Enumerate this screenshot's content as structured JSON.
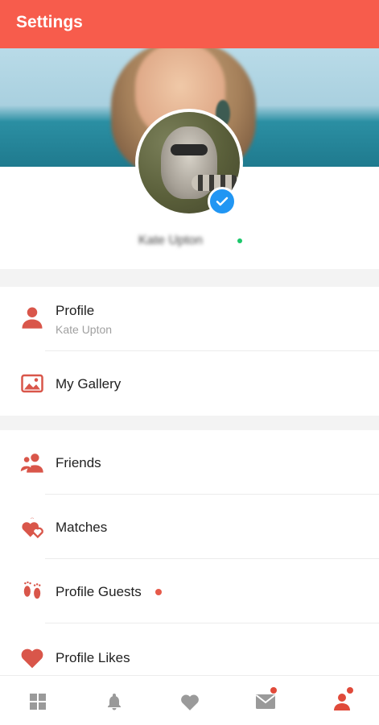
{
  "header": {
    "title": "Settings"
  },
  "profile_header": {
    "name": "Kate Upton"
  },
  "menu": {
    "profile": {
      "label": "Profile",
      "sub": "Kate Upton"
    },
    "gallery": {
      "label": "My Gallery"
    },
    "friends": {
      "label": "Friends"
    },
    "matches": {
      "label": "Matches"
    },
    "guests": {
      "label": "Profile Guests"
    },
    "likes": {
      "label": "Profile Likes"
    }
  },
  "colors": {
    "accent": "#f75c4c",
    "icon": "#d9564a",
    "verified": "#2196f3",
    "online": "#1cc76b"
  },
  "tabs": [
    {
      "icon": "grid-icon"
    },
    {
      "icon": "bell-icon"
    },
    {
      "icon": "heart-icon"
    },
    {
      "icon": "mail-icon",
      "badge": true
    },
    {
      "icon": "person-icon",
      "badge": true,
      "active": true
    }
  ]
}
